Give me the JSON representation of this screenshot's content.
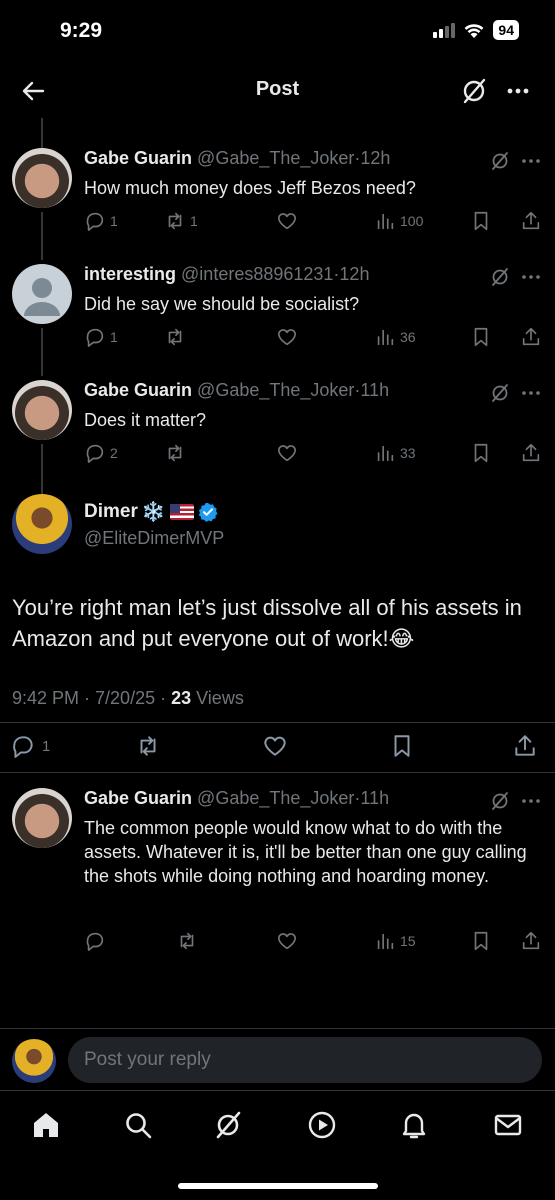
{
  "status_bar": {
    "time": "9:29",
    "battery": "94"
  },
  "nav": {
    "title": "Post"
  },
  "replies_above": [
    {
      "name": "Gabe Guarin",
      "handle": "@Gabe_The_Joker",
      "time": "12h",
      "text": "How much money does Jeff Bezos need?",
      "replies": "1",
      "reposts": "1",
      "likes": "",
      "views": "100",
      "avatar": "photo"
    },
    {
      "name": "interesting",
      "handle": "@interes88961231",
      "time": "12h",
      "text": "Did he say we should be socialist?",
      "replies": "1",
      "reposts": "",
      "likes": "",
      "views": "36",
      "avatar": "default"
    },
    {
      "name": "Gabe Guarin",
      "handle": "@Gabe_The_Joker",
      "time": "11h",
      "text": "Does it matter?",
      "replies": "2",
      "reposts": "",
      "likes": "",
      "views": "33",
      "avatar": "photo"
    }
  ],
  "main_post": {
    "name": "Dimer",
    "name_emoji": "❄️",
    "handle": "@EliteDimerMVP",
    "text": "You’re right man let’s just dissolve all of his assets in Amazon and put everyone out of work!😂",
    "datetime": "9:42 PM · 7/20/25 · ",
    "views_count": "23",
    "views_label": " Views",
    "replies": "1",
    "reposts": "",
    "likes": ""
  },
  "reply_below": {
    "name": "Gabe Guarin",
    "handle": "@Gabe_The_Joker",
    "time": "11h",
    "text": "The common people would know what to do with the assets. Whatever it is, it'll be better than one guy calling the shots while doing nothing and hoarding money.",
    "replies": "",
    "reposts": "",
    "likes": "",
    "views": "15"
  },
  "compose": {
    "placeholder": "Post your reply"
  },
  "icons": {
    "back": "arrow-left-icon",
    "grok": "grok-icon",
    "more": "more-icon",
    "reply": "reply-icon",
    "repost": "repost-icon",
    "like": "heart-icon",
    "views": "views-icon",
    "bookmark": "bookmark-icon",
    "share": "share-icon",
    "verified": "verified-badge-icon",
    "tabs": [
      "home-icon",
      "search-icon",
      "grok-icon",
      "video-icon",
      "bell-icon",
      "mail-icon"
    ]
  },
  "colors": {
    "background": "#000000",
    "text": "#e7e9ea",
    "muted": "#71767b",
    "verified": "#1d9bf0"
  }
}
